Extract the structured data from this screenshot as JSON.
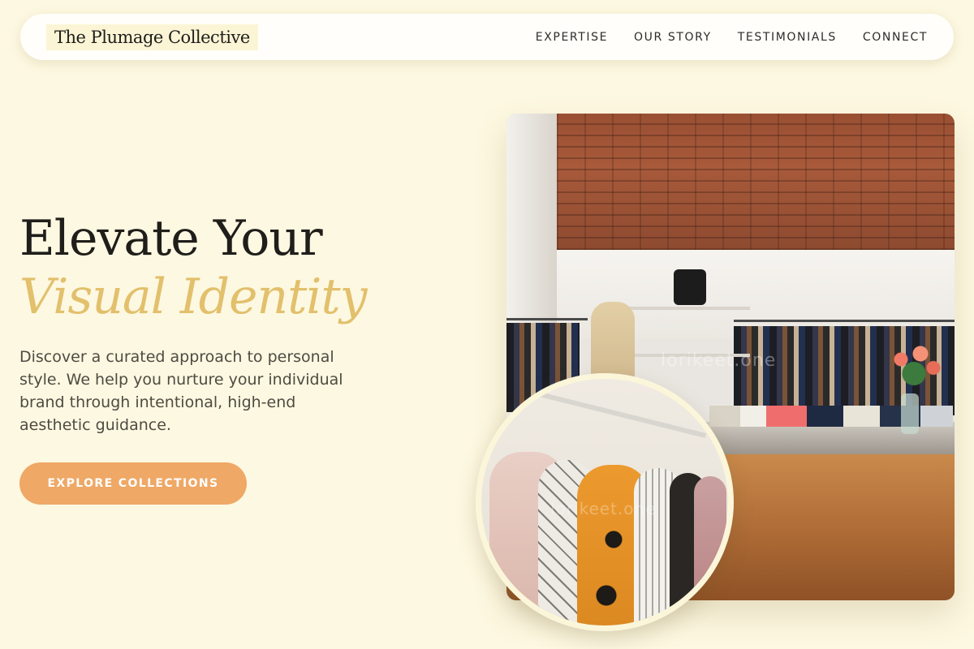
{
  "header": {
    "logo": "The Plumage Collective",
    "nav": [
      {
        "label": "EXPERTISE"
      },
      {
        "label": "OUR STORY"
      },
      {
        "label": "TESTIMONIALS"
      },
      {
        "label": "CONNECT"
      }
    ]
  },
  "hero": {
    "title_line1": "Elevate Your",
    "title_line2": "Visual Identity",
    "description": "Discover a curated approach to personal style. We help you nurture your individual brand through intentional, high-end aesthetic guidance.",
    "cta_label": "EXPLORE COLLECTIONS"
  },
  "images": {
    "main_watermark": "lorikeet.one",
    "circle_watermark": "lorikeet.one"
  },
  "colors": {
    "background": "#fdf8e1",
    "accent_gold": "#e2c06c",
    "cta": "#efa866",
    "text_dark": "#1f1e1a"
  }
}
